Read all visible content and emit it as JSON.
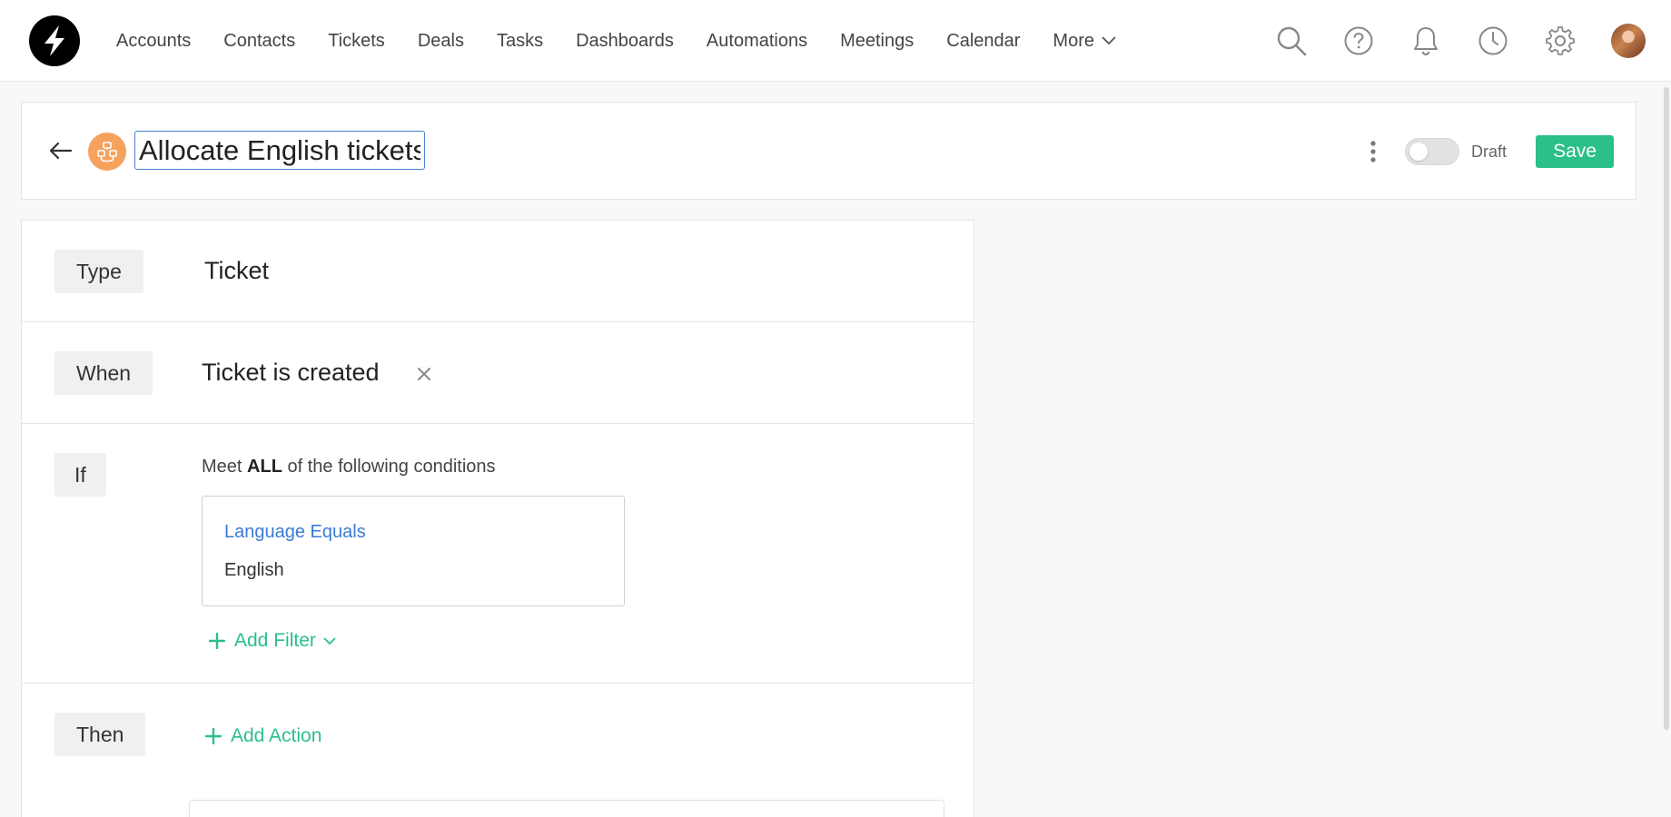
{
  "nav": {
    "links": [
      "Accounts",
      "Contacts",
      "Tickets",
      "Deals",
      "Tasks",
      "Dashboards",
      "Automations",
      "Meetings",
      "Calendar"
    ],
    "more_label": "More"
  },
  "header": {
    "title_value": "Allocate English tickets",
    "status_label": "Draft",
    "save_label": "Save"
  },
  "builder": {
    "type": {
      "label": "Type",
      "value": "Ticket"
    },
    "when": {
      "label": "When",
      "value": "Ticket is created"
    },
    "if": {
      "label": "If",
      "meet_prefix": "Meet ",
      "meet_keyword": "ALL",
      "meet_suffix": " of the following conditions",
      "conditions": [
        {
          "field": "Language Equals",
          "value": "English"
        }
      ],
      "add_filter_label": "Add Filter"
    },
    "then": {
      "label": "Then",
      "add_action_label": "Add Action"
    }
  },
  "colors": {
    "accent_green": "#2bbf8a",
    "link_blue": "#3a7bd5",
    "workflow_icon": "#f5a25d",
    "focus_border": "#4a7fd6"
  },
  "icons": [
    "logo-icon",
    "search-icon",
    "help-icon",
    "bell-icon",
    "clock-icon",
    "gear-icon",
    "back-arrow-icon",
    "workflow-icon",
    "kebab-icon",
    "close-icon",
    "plus-icon",
    "chevron-down-icon"
  ]
}
